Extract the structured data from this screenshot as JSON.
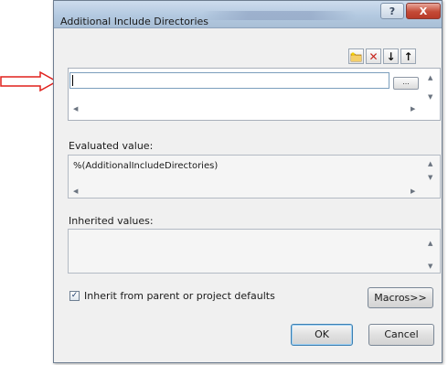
{
  "dialog": {
    "title": "Additional Include Directories",
    "help_label": "?",
    "close_label": "X"
  },
  "toolbar": {
    "icons": [
      "new-line-folder-icon",
      "delete-icon",
      "move-down-icon",
      "move-up-icon"
    ],
    "delete_glyph": "✕",
    "down_glyph": "↓",
    "up_glyph": "↑"
  },
  "edit_list": {
    "value": "",
    "browse_label": "..."
  },
  "evaluated": {
    "label": "Evaluated value:",
    "value": "%(AdditionalIncludeDirectories)"
  },
  "inherited": {
    "label": "Inherited values:"
  },
  "inherit_checkbox": {
    "checked": true,
    "label": "Inherit from parent or project defaults"
  },
  "buttons": {
    "macros": "Macros>>",
    "ok": "OK",
    "cancel": "Cancel"
  },
  "annotation_color": "#e0201c"
}
